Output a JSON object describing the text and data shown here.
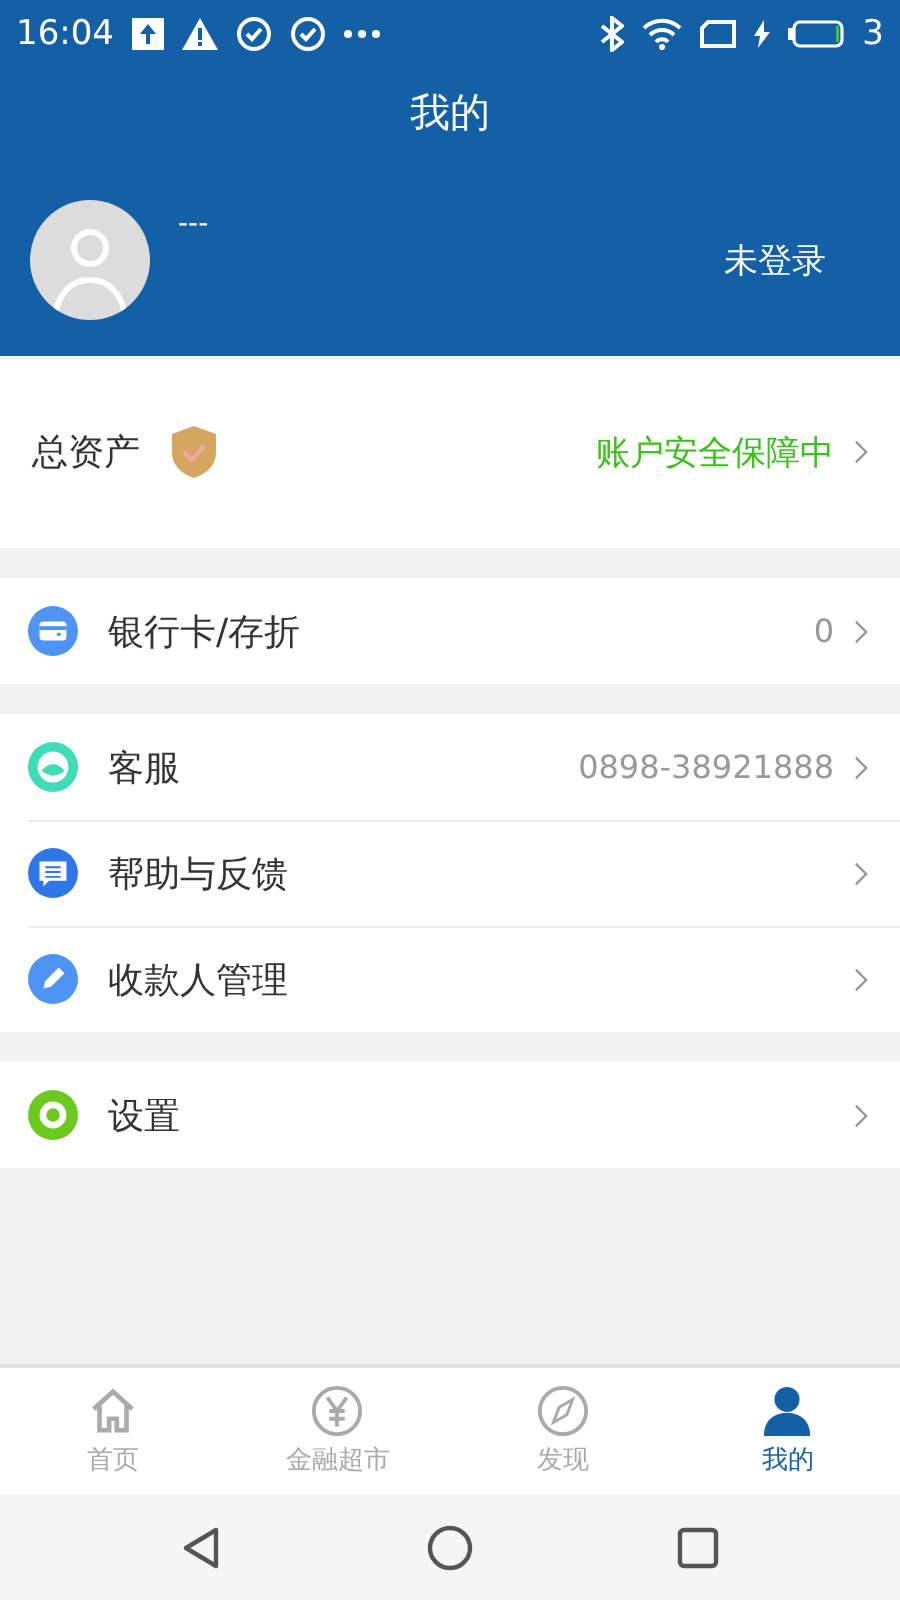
{
  "status_bar": {
    "time": "16:04",
    "battery_text": "3"
  },
  "header": {
    "title": "我的"
  },
  "profile": {
    "name": "---",
    "login_status": "未登录"
  },
  "assets": {
    "label": "总资产",
    "security_text": "账户安全保障中"
  },
  "menu_groups": [
    {
      "items": [
        {
          "kind": "card",
          "label": "银行卡/存折",
          "value": "0"
        }
      ]
    },
    {
      "items": [
        {
          "kind": "service",
          "label": "客服",
          "value": "0898-38921888"
        },
        {
          "kind": "chat",
          "label": "帮助与反馈"
        },
        {
          "kind": "pen",
          "label": "收款人管理"
        }
      ]
    },
    {
      "items": [
        {
          "kind": "gear",
          "label": "设置"
        }
      ]
    }
  ],
  "tabs": [
    {
      "kind": "home",
      "label": "首页",
      "selected": false
    },
    {
      "kind": "yen",
      "label": "金融超市",
      "selected": false
    },
    {
      "kind": "compass",
      "label": "发现",
      "selected": false
    },
    {
      "kind": "person",
      "label": "我的",
      "selected": true
    }
  ]
}
